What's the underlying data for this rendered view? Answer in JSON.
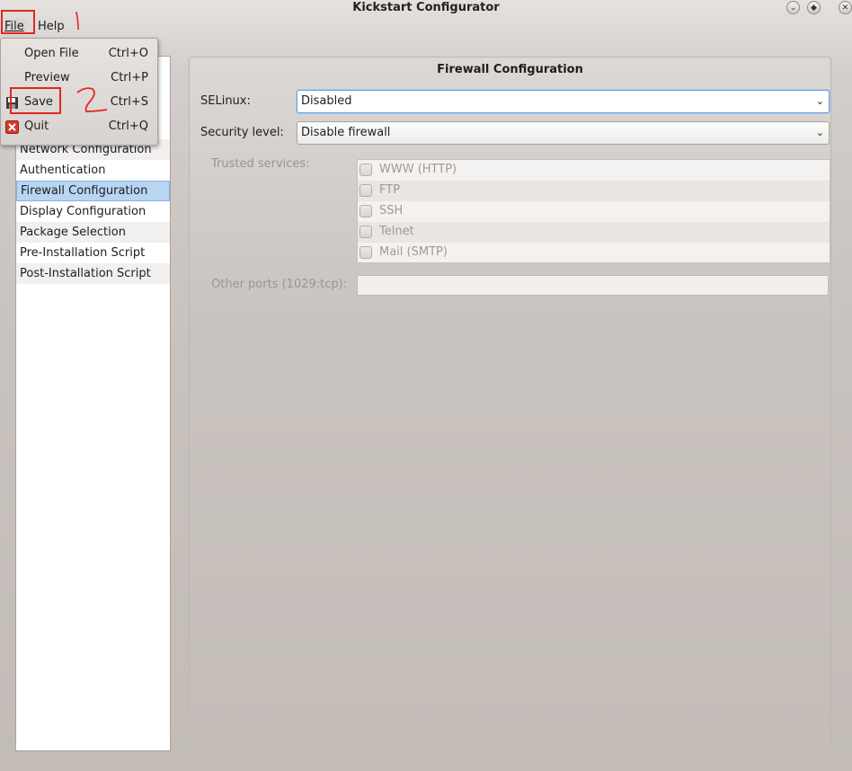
{
  "window": {
    "title": "Kickstart Configurator"
  },
  "menubar": {
    "file": "File",
    "help": "Help"
  },
  "file_menu": {
    "items": [
      {
        "label": "Open File",
        "accel": "Ctrl+O"
      },
      {
        "label": "Preview",
        "accel": "Ctrl+P"
      },
      {
        "label": "Save",
        "accel": "Ctrl+S"
      },
      {
        "label": "Quit",
        "accel": "Ctrl+Q"
      }
    ]
  },
  "sidebar": {
    "items": [
      {
        "label": "Network Configuration"
      },
      {
        "label": "Authentication"
      },
      {
        "label": "Firewall Configuration",
        "selected": true
      },
      {
        "label": "Display Configuration"
      },
      {
        "label": "Package Selection"
      },
      {
        "label": "Pre-Installation Script"
      },
      {
        "label": "Post-Installation Script"
      }
    ]
  },
  "firewall": {
    "title": "Firewall Configuration",
    "selinux_label": "SELinux:",
    "selinux_value": "Disabled",
    "security_label": "Security level:",
    "security_value": "Disable firewall",
    "trusted_label": "Trusted services:",
    "services": [
      "WWW (HTTP)",
      "FTP",
      "SSH",
      "Telnet",
      "Mail (SMTP)"
    ],
    "other_ports_label": "Other ports (1029:tcp):",
    "other_ports_value": ""
  },
  "annotations": {
    "step1": "1",
    "step2": "2",
    "color": "#e0281f"
  }
}
